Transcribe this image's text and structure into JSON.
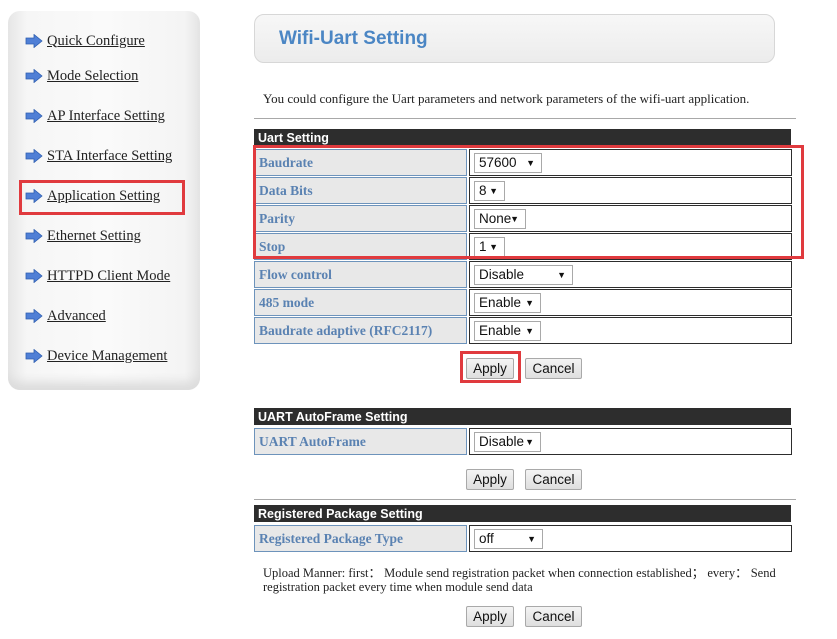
{
  "sidebar": {
    "items": [
      {
        "label": "Quick Configure"
      },
      {
        "label": "Mode Selection"
      },
      {
        "label": "AP Interface Setting"
      },
      {
        "label": "STA Interface Setting"
      },
      {
        "label": "Application Setting",
        "highlighted": true
      },
      {
        "label": "Ethernet Setting"
      },
      {
        "label": "HTTPD Client Mode"
      },
      {
        "label": "Advanced"
      },
      {
        "label": "Device Management"
      }
    ]
  },
  "header": {
    "title": "Wifi-Uart Setting",
    "intro": "You could configure the Uart parameters and network parameters of the wifi-uart application."
  },
  "uart": {
    "title": "Uart Setting",
    "rows": [
      {
        "label": "Baudrate",
        "value": "57600"
      },
      {
        "label": "Data Bits",
        "value": "8"
      },
      {
        "label": "Parity",
        "value": "None"
      },
      {
        "label": "Stop",
        "value": "1"
      },
      {
        "label": "Flow control",
        "value": "Disable"
      },
      {
        "label": "485 mode",
        "value": "Enable"
      },
      {
        "label": "Baudrate adaptive (RFC2117)",
        "value": "Enable"
      }
    ],
    "apply": "Apply",
    "cancel": "Cancel"
  },
  "autoframe": {
    "title": "UART AutoFrame Setting",
    "rows": [
      {
        "label": "UART AutoFrame",
        "value": "Disable"
      }
    ],
    "apply": "Apply",
    "cancel": "Cancel"
  },
  "regpkg": {
    "title": "Registered Package Setting",
    "rows": [
      {
        "label": "Registered Package Type",
        "value": "off"
      }
    ],
    "note": "Upload Manner: first： Module send registration packet when connection established； every： Send registration packet every time when module send data",
    "apply": "Apply",
    "cancel": "Cancel"
  },
  "colors": {
    "highlight": "#e03a3e",
    "label_text": "#5a82b2",
    "section_bg": "#2d2d2d",
    "title_blue": "#4b86c4"
  },
  "icons": {
    "nav_arrow": "arrow-right-icon",
    "select_caret": "caret-down-icon"
  }
}
